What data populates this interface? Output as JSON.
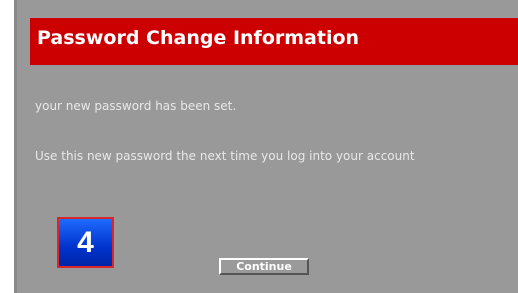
{
  "header": {
    "title": "Password Change Information",
    "background_color": "#cc0000"
  },
  "messages": {
    "line1": "your new password has been set.",
    "line2": "Use this new password the next time you log into your account"
  },
  "step_badge": {
    "number": "4",
    "fill_color": "#0033cc",
    "border_color": "#d8262b"
  },
  "actions": {
    "continue_label": "Continue"
  },
  "colors": {
    "panel_background": "#999999"
  }
}
